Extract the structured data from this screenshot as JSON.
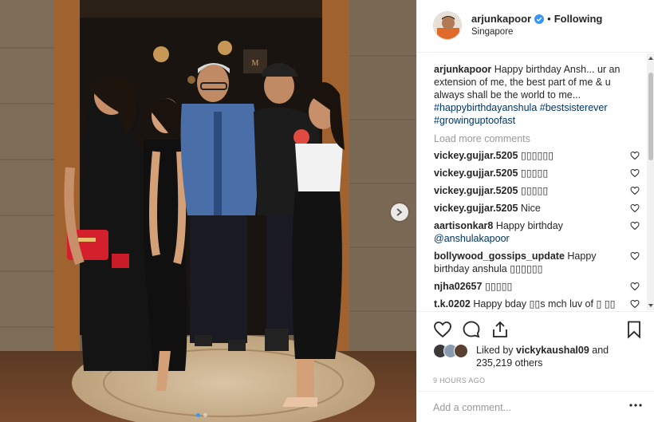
{
  "post": {
    "username": "arjunkapoor",
    "verified_icon": "verified-badge-icon",
    "separator": "•",
    "follow_status": "Following",
    "location": "Singapore"
  },
  "caption": {
    "username": "arjunkapoor",
    "text": " Happy birthday Ansh... ur an extension of me, the best part of me & u always shall be the world to me... ",
    "hashtags": [
      "#happybirthdayanshula",
      "#bestsisterever",
      "#growinguptoofast"
    ]
  },
  "load_more": "Load more comments",
  "comments": [
    {
      "user": "vickey.gujjar.5205",
      "text": " ▯▯▯▯▯▯"
    },
    {
      "user": "vickey.gujjar.5205",
      "text": " ▯▯▯▯▯"
    },
    {
      "user": "vickey.gujjar.5205",
      "text": " ▯▯▯▯▯"
    },
    {
      "user": "vickey.gujjar.5205",
      "text": " Nice"
    },
    {
      "user": "aartisonkar8",
      "text": " Happy birthday ",
      "mention": "@anshulakapoor"
    },
    {
      "user": "bollywood_gossips_update",
      "text": " Happy birthday anshula ▯▯▯▯▯▯"
    },
    {
      "user": "njha02657",
      "text": " ▯▯▯▯▯"
    },
    {
      "user": "t.k.0202",
      "text": " Happy bday ▯▯s mch luv of ▯ ▯▯"
    }
  ],
  "likes": {
    "prefix": "Liked by ",
    "user": "vickykaushal09",
    "middle": " and",
    "count": "235,219 others"
  },
  "timestamp": "9 HOURS AGO",
  "add_comment": {
    "placeholder": "Add a comment..."
  },
  "colors": {
    "link": "#003569",
    "accent": "#3897f0",
    "muted": "#999999"
  },
  "icons": [
    "heart-icon",
    "comment-icon",
    "share-icon",
    "bookmark-icon",
    "more-options-icon",
    "chevron-right-icon"
  ],
  "carousel": {
    "total": 2,
    "active": 1
  }
}
